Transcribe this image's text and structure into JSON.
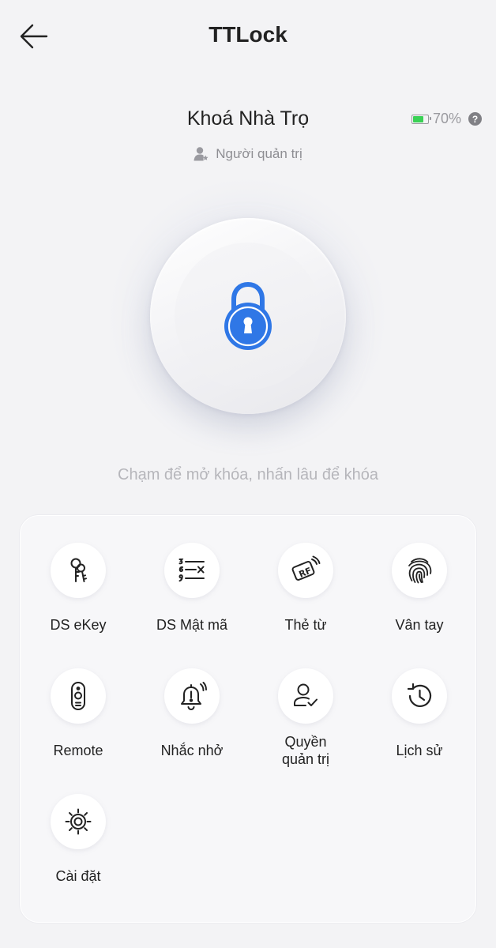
{
  "header": {
    "title": "TTLock"
  },
  "lock": {
    "name": "Khoá Nhà Trọ",
    "battery_percent": 70,
    "battery_text": "70%",
    "help_glyph": "?",
    "role": "Người quản trị",
    "hint": "Chạm để mở khóa, nhấn lâu để khóa",
    "accent_color": "#2f77e6",
    "battery_color": "#3ad155"
  },
  "menu": {
    "items": [
      {
        "label": "DS eKey",
        "icon": "ekey-icon"
      },
      {
        "label": "DS Mật mã",
        "icon": "passcode-list-icon"
      },
      {
        "label": "Thẻ từ",
        "icon": "rf-card-icon"
      },
      {
        "label": "Vân tay",
        "icon": "fingerprint-icon"
      },
      {
        "label": "Remote",
        "icon": "remote-icon"
      },
      {
        "label": "Nhắc nhở",
        "icon": "bell-icon"
      },
      {
        "label_line1": "Quyền",
        "label_line2": "quản trị",
        "icon": "admin-rights-icon"
      },
      {
        "label": "Lịch sử",
        "icon": "history-icon"
      },
      {
        "label": "Cài đặt",
        "icon": "settings-icon"
      }
    ]
  }
}
